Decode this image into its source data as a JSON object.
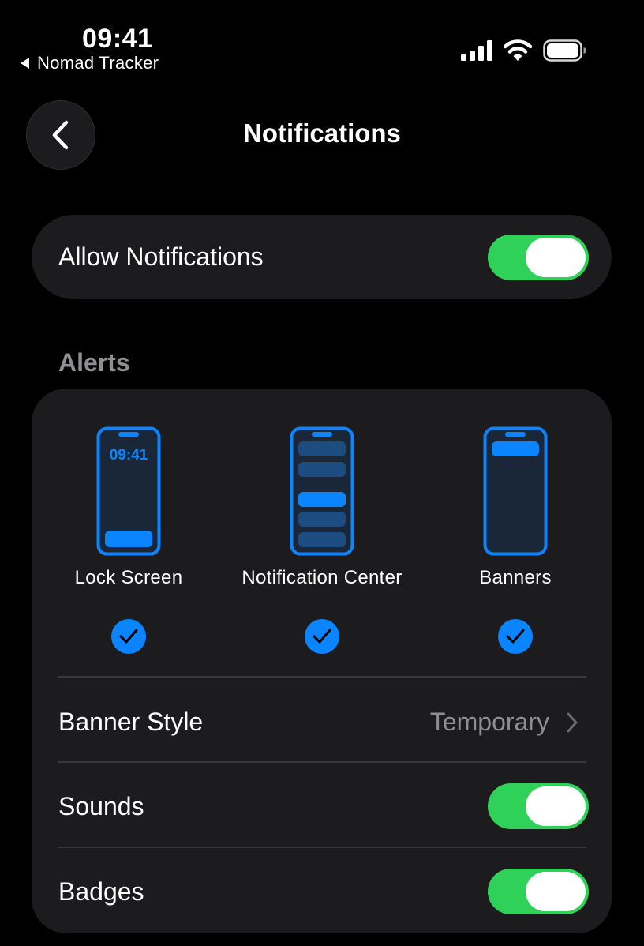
{
  "status_bar": {
    "time": "09:41",
    "back_app": "Nomad Tracker",
    "icons": [
      "cellular-signal-icon",
      "wifi-icon",
      "battery-icon"
    ]
  },
  "nav": {
    "title": "Notifications"
  },
  "allow": {
    "label": "Allow Notifications",
    "enabled": true
  },
  "alerts": {
    "header": "Alerts",
    "options": [
      {
        "label": "Lock Screen",
        "icon": "lock-screen-phone-icon",
        "time": "09:41",
        "checked": true
      },
      {
        "label": "Notification Center",
        "icon": "notification-center-phone-icon",
        "checked": true
      },
      {
        "label": "Banners",
        "icon": "banners-phone-icon",
        "checked": true
      }
    ],
    "banner_style": {
      "label": "Banner Style",
      "value": "Temporary"
    },
    "sounds": {
      "label": "Sounds",
      "enabled": true
    },
    "badges": {
      "label": "Badges",
      "enabled": true
    }
  },
  "colors": {
    "accent": "#0a84ff",
    "toggle_on": "#30d158",
    "card": "#1c1c1e",
    "secondary_text": "#8e8e93"
  }
}
